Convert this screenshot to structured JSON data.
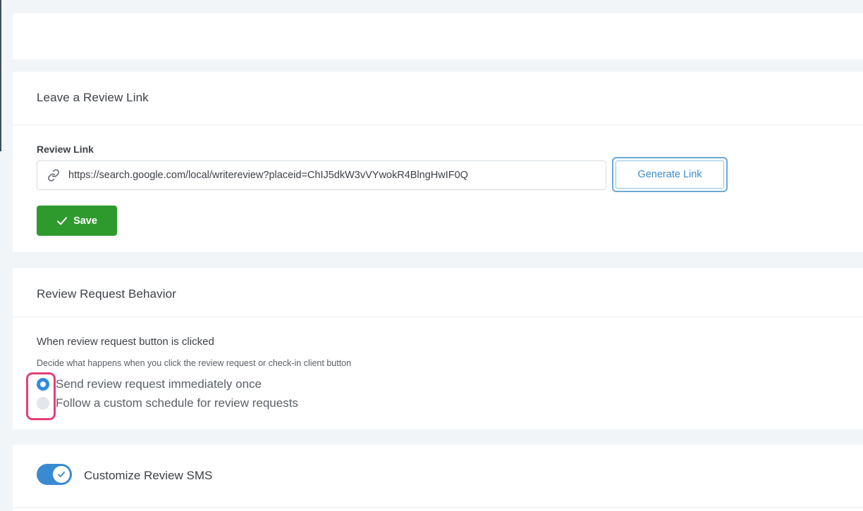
{
  "review_link_card": {
    "title": "Leave a Review Link",
    "field_label": "Review Link",
    "url_value": "https://search.google.com/local/writereview?placeid=ChIJ5dkW3vVYwokR4BlngHwIF0Q",
    "link_icon": "link-icon",
    "generate_label": "Generate Link",
    "save_label": "Save",
    "save_icon": "check-icon"
  },
  "behavior_card": {
    "title": "Review Request Behavior",
    "subheading": "When review request button is clicked",
    "help": "Decide what happens when you click the review request or check-in client button",
    "options": [
      {
        "label": "Send review request immediately once",
        "selected": true
      },
      {
        "label": "Follow a custom schedule for review requests",
        "selected": false
      }
    ]
  },
  "sms_card": {
    "toggle_label": "Customize Review SMS",
    "toggle_on": true
  },
  "colors": {
    "accent_blue": "#2f8be0",
    "save_green": "#2e9a2e",
    "highlight_pink": "#e33f78"
  }
}
